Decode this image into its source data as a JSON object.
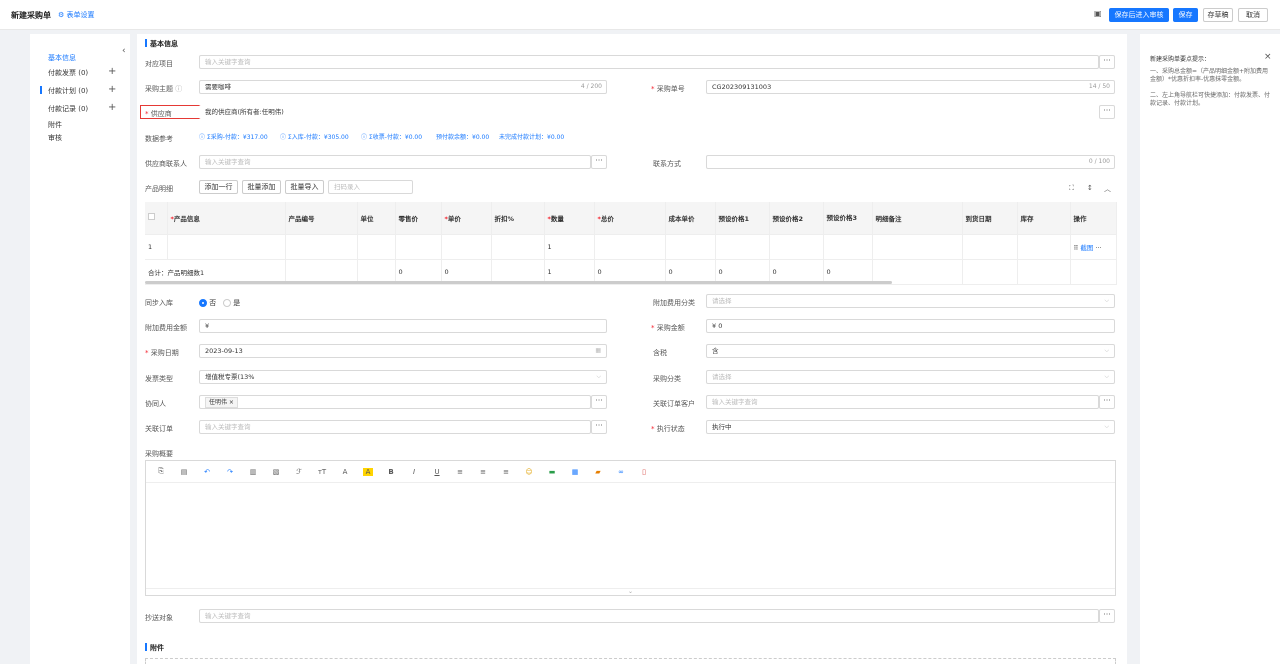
{
  "header": {
    "title": "新建采购单",
    "form_settings": "表单设置",
    "btn_save_audit": "保存后进入审核",
    "btn_save": "保存",
    "btn_draft": "存草稿",
    "btn_cancel": "取消"
  },
  "nav": {
    "items": [
      {
        "label": "基本信息",
        "count": "",
        "has_plus": false
      },
      {
        "label": "付款发票",
        "count": "(0)",
        "has_plus": true
      },
      {
        "label": "付款计划",
        "count": "(0)",
        "has_plus": true
      },
      {
        "label": "付款记录",
        "count": "(0)",
        "has_plus": true
      },
      {
        "label": "附件",
        "count": "",
        "has_plus": false
      },
      {
        "label": "审核",
        "count": "",
        "has_plus": false
      }
    ]
  },
  "section_basic": "基本信息",
  "section_attach": "附件",
  "form": {
    "project": {
      "label": "对应项目",
      "placeholder": "输入关键字查询"
    },
    "subject": {
      "label": "采购主题",
      "value": "需要咖啡",
      "counter": "4 / 200"
    },
    "order_no": {
      "label": "采购单号",
      "value": "CG202309131003",
      "counter": "14 / 50"
    },
    "supplier": {
      "label": "供应商",
      "value": "我的供应商(所有者:任明伟)"
    },
    "ref_data": {
      "label": "数据参考",
      "items": [
        "Σ采购-付款：¥317.00",
        "Σ入库-付款：¥305.00",
        "Σ收票-付款：¥0.00",
        "预付款余额：¥0.00",
        "未完成付款计划：¥0.00"
      ]
    },
    "contact": {
      "label": "供应商联系人",
      "placeholder": "输入关键字查询"
    },
    "contact_method": {
      "label": "联系方式",
      "counter": "0 / 100"
    },
    "product": {
      "label": "产品明细",
      "btn_add_row": "添加一行",
      "btn_batch_add": "批量添加",
      "btn_batch_import": "批量导入",
      "scan_placeholder": "扫码录入"
    },
    "sync_stock": {
      "label": "同步入库",
      "opt_no": "否",
      "opt_yes": "是"
    },
    "extra_cost_type": {
      "label": "附加费用分类",
      "placeholder": "请选择"
    },
    "extra_cost_amount": {
      "label": "附加费用金额",
      "value": "¥"
    },
    "purchase_amount": {
      "label": "采购金额",
      "value": "¥ 0"
    },
    "purchase_date": {
      "label": "采购日期",
      "value": "2023-09-13"
    },
    "tax": {
      "label": "含税",
      "value": "含"
    },
    "invoice_type": {
      "label": "发票类型",
      "value": "增值税专票(13%"
    },
    "purchase_category": {
      "label": "采购分类",
      "placeholder": "请选择"
    },
    "collaborator": {
      "label": "协同人",
      "tag": "任明伟"
    },
    "related_customer": {
      "label": "关联订单客户",
      "placeholder": "输入关键字查询"
    },
    "related_order": {
      "label": "关联订单",
      "placeholder": "输入关键字查询"
    },
    "exec_status": {
      "label": "执行状态",
      "value": "执行中"
    },
    "summary": {
      "label": "采购概要"
    },
    "cc": {
      "label": "抄送对象",
      "placeholder": "输入关键字查询"
    }
  },
  "table": {
    "headers": [
      "产品信息",
      "产品编号",
      "单位",
      "零售价",
      "单价",
      "折扣%",
      "数量",
      "总价",
      "成本单价",
      "预设价格1",
      "预设价格2",
      "预设价格3",
      "明细备注",
      "到货日期",
      "库存",
      "操作"
    ],
    "row": {
      "no": "1",
      "qty": "1",
      "op_link": "截图"
    },
    "total": {
      "label": "合计：产品明细数1",
      "retail": "0",
      "price": "0",
      "qty": "1",
      "total": "0",
      "cost": "0",
      "p1": "0",
      "p2": "0",
      "p3": "0"
    }
  },
  "tip": {
    "title": "新建采购单要点提示：",
    "lines": [
      "一、采购总金额=（产品明细金额+附加费用金额）*优惠折扣率-优惠抹零金额。",
      "二、左上角导航栏可快捷添加：付款发票、付款记录、付款计划。"
    ]
  },
  "toolbar_icons": [
    "copy-icon",
    "paste-icon",
    "undo-icon",
    "redo-icon",
    "format-painter-icon",
    "clear-format-icon",
    "font-family-icon",
    "font-size-icon",
    "font-color-icon",
    "highlight-icon",
    "bold-icon",
    "italic-icon",
    "underline-icon",
    "align-left-icon",
    "align-center-icon",
    "align-right-icon",
    "emoji-icon",
    "image-icon",
    "table-icon",
    "video-icon",
    "link-icon",
    "attachment-icon"
  ]
}
